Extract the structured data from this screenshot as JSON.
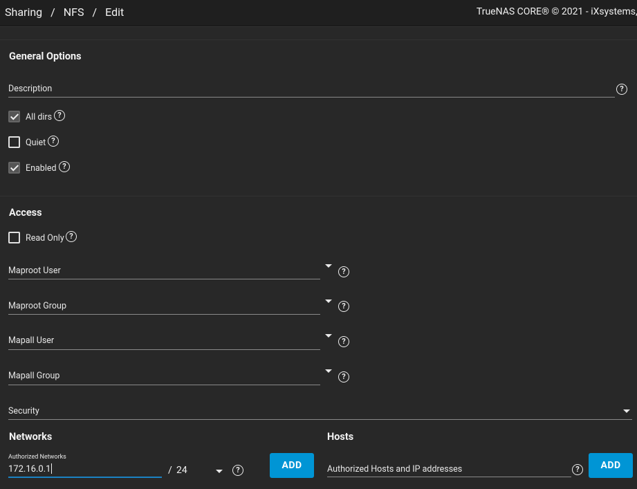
{
  "header": {
    "breadcrumb": [
      "Sharing",
      "NFS",
      "Edit"
    ],
    "copyright": "TrueNAS CORE® © 2021 - iXsystems, I"
  },
  "general": {
    "title": "General Options",
    "description_label": "Description",
    "alldirs_label": "All dirs",
    "alldirs_checked": true,
    "quiet_label": "Quiet",
    "quiet_checked": false,
    "enabled_label": "Enabled",
    "enabled_checked": true
  },
  "access": {
    "title": "Access",
    "readonly_label": "Read Only",
    "readonly_checked": false,
    "maproot_user_label": "Maproot User",
    "maproot_group_label": "Maproot Group",
    "mapall_user_label": "Mapall User",
    "mapall_group_label": "Mapall Group",
    "security_label": "Security"
  },
  "networks": {
    "title": "Networks",
    "field_label": "Authorized Networks",
    "value": "172.16.0.1",
    "slash": "/",
    "mask": "24",
    "add_label": "ADD"
  },
  "hosts": {
    "title": "Hosts",
    "field_label": "Authorized Hosts and IP addresses",
    "add_label": "ADD"
  },
  "icons": {
    "help": "help-circle-icon",
    "dropdown": "caret-down-icon",
    "check": "check-icon"
  },
  "colors": {
    "background": "#282828",
    "topbar": "#1f1f1f",
    "accent": "#0095d5"
  }
}
